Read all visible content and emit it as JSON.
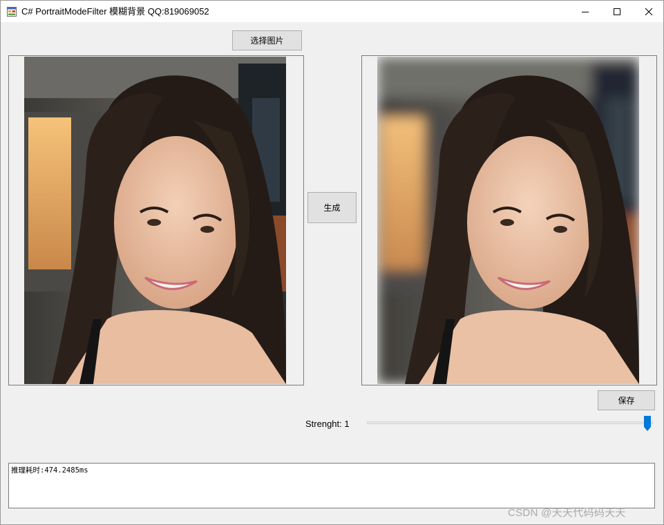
{
  "window": {
    "title": "C# PortraitModeFilter 模糊背景 QQ:819069052",
    "minimize_icon": "minimize-icon",
    "maximize_icon": "maximize-icon",
    "close_icon": "close-icon"
  },
  "buttons": {
    "select_image": "选择图片",
    "generate": "生成",
    "save": "保存"
  },
  "images": {
    "original_icon": "portrait-photo",
    "result_icon": "blurred-background-portrait-photo"
  },
  "strength": {
    "label": "Strenght: 1",
    "value": 1,
    "fraction": 1.0
  },
  "log": {
    "text": "推理耗时:474.2485ms"
  },
  "watermark": {
    "text": "CSDN @天天代码码天天"
  },
  "colors": {
    "accent": "#0078d7",
    "window_bg": "#f0f0f0",
    "button_bg": "#e1e1e1"
  }
}
